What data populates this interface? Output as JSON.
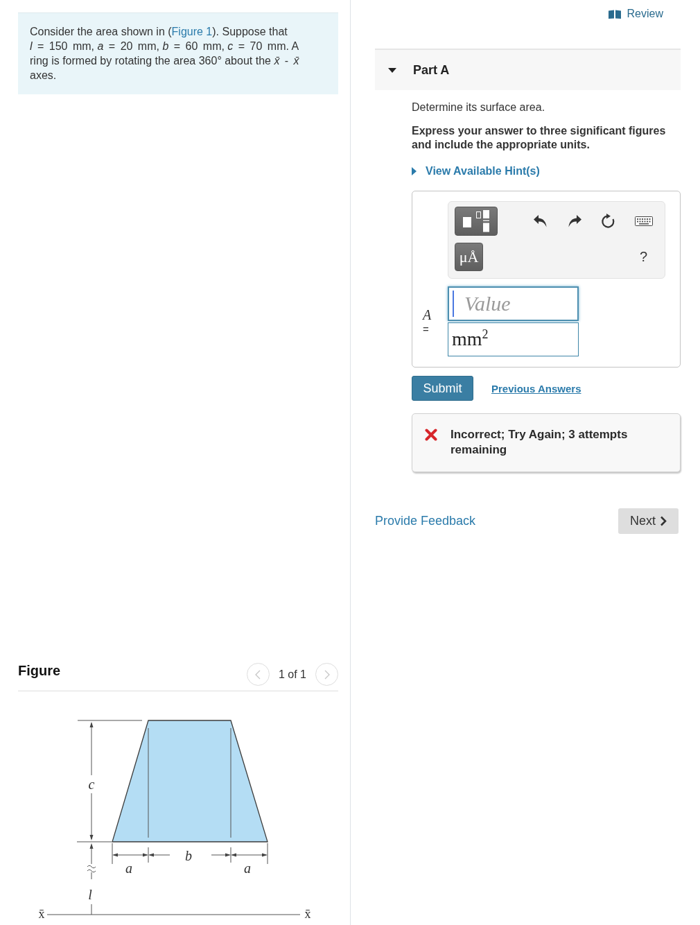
{
  "problem": {
    "segments": [
      {
        "kind": "text",
        "text": "Consider the area shown in ("
      },
      {
        "kind": "link",
        "text": "Figure 1"
      },
      {
        "kind": "text",
        "text": "). Suppose that "
      },
      {
        "kind": "math",
        "text": "*l* = 150 mm"
      },
      {
        "kind": "text",
        "text": ", "
      },
      {
        "kind": "math",
        "text": "*a* = 20 mm"
      },
      {
        "kind": "text",
        "text": ", "
      },
      {
        "kind": "math",
        "text": "*b* = 60 mm"
      },
      {
        "kind": "text",
        "text": ", "
      },
      {
        "kind": "math",
        "text": "*c* = 70 mm"
      },
      {
        "kind": "text",
        "text": ". A ring is formed by rotating the area 360° about the "
      },
      {
        "kind": "math",
        "text": "*x̄* - *x̄*"
      },
      {
        "kind": "text",
        "text": " axes."
      }
    ]
  },
  "figure": {
    "title": "Figure",
    "pager": {
      "prev": {
        "disabled": true
      },
      "label": "1 of 1",
      "next": {
        "disabled": true
      }
    },
    "labels": {
      "c": "c",
      "b": "b",
      "a_left": "a",
      "a_right": "a",
      "l": "l",
      "axis_left": "x̄",
      "axis_right": "x̄"
    }
  },
  "review": {
    "label": "Review"
  },
  "part": {
    "title": "Part A",
    "expanded": true,
    "question": "Determine its surface area.",
    "instructions": "Express your answer to three significant figures and include the appropriate units.",
    "hint": {
      "label": "View Available Hint(s)",
      "expanded": false
    }
  },
  "answer": {
    "toolbar": {
      "symbol_button": "μÅ",
      "help": "?"
    },
    "variable": "A",
    "equals": "=",
    "value": {
      "placeholder": "Value",
      "focused": true
    },
    "units": {
      "value": "mm$^{2}$"
    }
  },
  "actions": {
    "submit": "Submit",
    "previous_answers": "Previous Answers"
  },
  "feedback": {
    "kind": "incorrect",
    "message": "Incorrect; Try Again; 3 attempts remaining"
  },
  "footer": {
    "provide_feedback": "Provide Feedback",
    "next": "Next"
  }
}
